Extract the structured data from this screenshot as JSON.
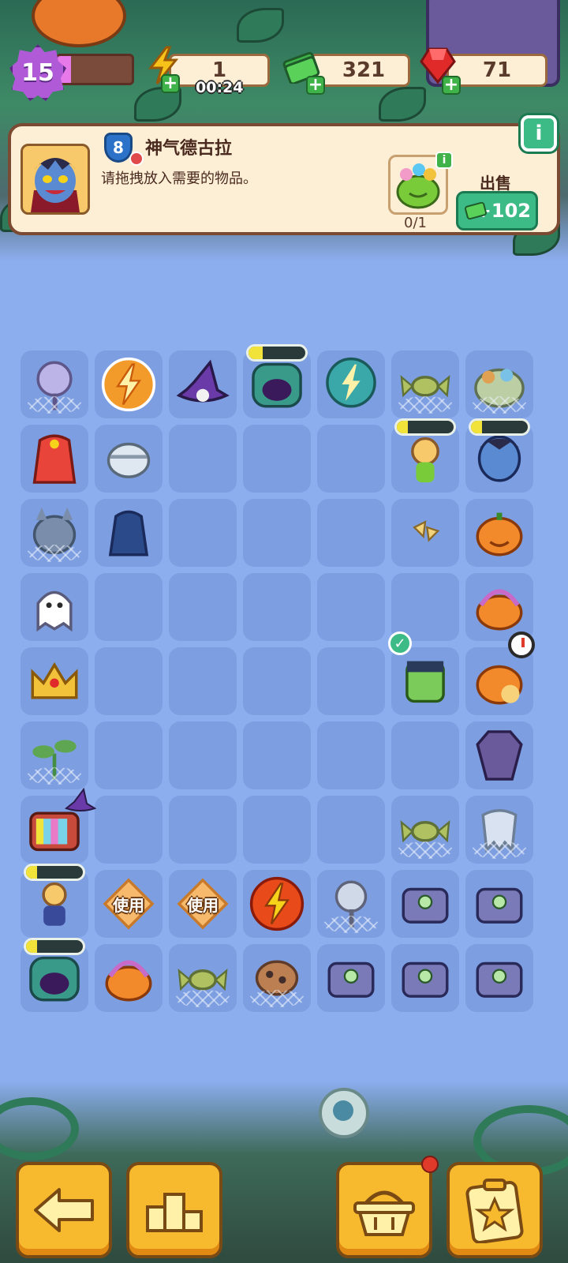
{
  "hud": {
    "level": "15",
    "xp_fraction": 0.18,
    "energy": "1",
    "energy_timer": "00:24",
    "cash": "321",
    "gems": "71",
    "colors": {
      "cash": "#3fb24a",
      "gem": "#e02a2a",
      "energy": "#f2b21a",
      "level": "#b05ad8"
    }
  },
  "order": {
    "level_badge": "8",
    "customer_name": "神气德古拉",
    "description": "请拖拽放入需要的物品。",
    "requirement_icon": "candy-cauldron-icon",
    "requirement_count": "0/1",
    "sell_label": "出售",
    "sell_value": "+102",
    "info_label": "i"
  },
  "board": {
    "use_label": "使用",
    "progress_fills": {
      "r0c3": 0.25,
      "r1c5": 0.2,
      "r1c6": 0.2,
      "r7c0": 0.2,
      "r8c0": 0.2
    }
  },
  "bottom_bar": {
    "buttons": [
      "back-arrow-icon",
      "leaderboard-icon",
      "shop-basket-icon",
      "task-clipboard-icon"
    ],
    "colors": {
      "button": "#f7b92e",
      "notification": "#e03a2a"
    }
  }
}
